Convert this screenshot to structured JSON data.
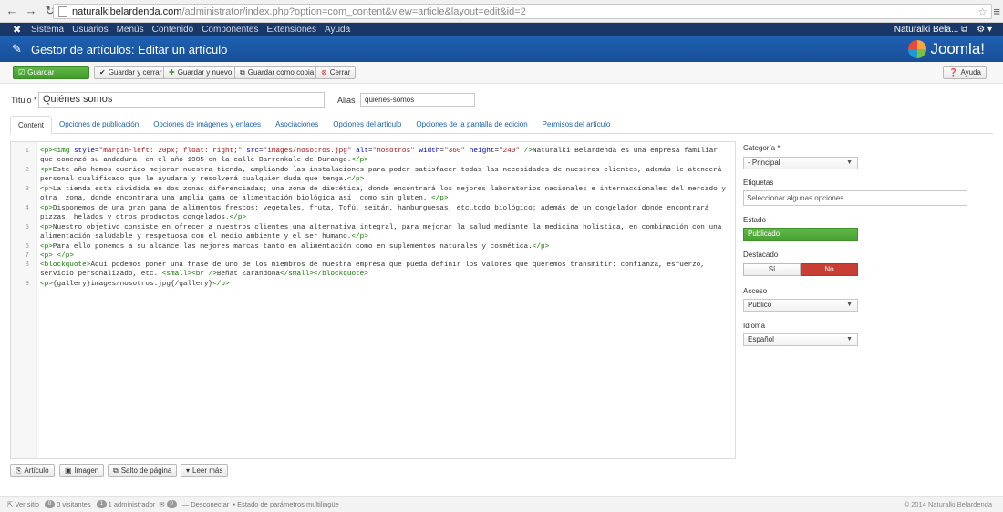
{
  "browser": {
    "url_host": "naturalkibelardenda.com",
    "url_path": "/administrator/index.php?option=com_content&view=article&layout=edit&id=2"
  },
  "topnav": {
    "items": [
      "Sistema",
      "Usuarios",
      "Menús",
      "Contenido",
      "Componentes",
      "Extensiones",
      "Ayuda"
    ],
    "user": "Naturalki Bela...",
    "icons": [
      "joomla-icon",
      "external-link-icon",
      "gear-icon"
    ]
  },
  "header": {
    "title": "Gestor de artículos: Editar un artículo",
    "brand": "Joomla!"
  },
  "toolbar": {
    "save": "Guardar",
    "save_close": "Guardar y cerrar",
    "save_new": "Guardar y nuevo",
    "save_copy": "Guardar como copia",
    "close": "Cerrar",
    "help": "Ayuda"
  },
  "form": {
    "title_label": "Título *",
    "title_value": "Quiénes somos",
    "alias_label": "Alias",
    "alias_value": "quienes-somos"
  },
  "tabs": [
    "Content",
    "Opciones de publicación",
    "Opciones de imágenes y enlaces",
    "Asociaciones",
    "Opciones del artículo",
    "Opciones de la pantalla de edición",
    "Permisos del artículo"
  ],
  "editor": {
    "line_numbers": [
      "1",
      "2",
      "3",
      "4",
      "5",
      "6",
      "7",
      "8",
      "9"
    ],
    "lines": [
      "<p><img style=\"margin-left: 20px; float: right;\" src=\"images/nosotros.jpg\" alt=\"nosotros\" width=\"360\" height=\"240\" />Naturalki Belardenda es una empresa familiar que comenzó su andadura  en el año 1985 en la calle Barrenkale de Durango.</p>",
      "<p>Este año hemos querido mejorar nuestra tienda, ampliando las instalaciones para poder satisfacer todas las necesidades de nuestros clientes, además le atenderá personal cualificado que le ayudara y resolverá cualquier duda que tenga.</p>",
      "<p>La tienda esta dividida en dos zonas diferenciadas; una zona de dietética, donde encontrará los mejores laboratorios nacionales e internaccíonales del mercado y otra  zona, donde encontrara una amplia gama de alimentación biológica así  como sin gluten. </p>",
      "<p>Disponemos de una gran gama de alimentos frescos; vegetales, fruta, Tofú, seitán, hamburguesas, etc…todo biológico; además de un congelador donde encontrará pizzas, helados y otros productos congelados.</p>",
      "<p>Nuestro objetivo consiste en ofrecer a nuestros clientes una alternativa integral, para mejorar la salud mediante la medicina holística, en combinación con una alimentación saludable y respetuosa con el medio ambiente y el ser humano.</p>",
      "<p>Para ello ponemos a su alcance las mejores marcas tanto en alimentación como en suplementos naturales y cosmética.</p>",
      "<p> </p>",
      "<blockquote>Aquí podemos poner una frase de uno de los miembros de nuestra empresa que pueda definir los valores que queremos transmitir: confianza, esfuerzo, servicio personalizado, etc. <small><br />Beñat Zarandona</small></blockquote>",
      "<p>{gallery}images/nosotros.jpg{/gallery}</p>"
    ]
  },
  "sidebar": {
    "category_label": "Categoría *",
    "category_value": "- Principal",
    "tags_label": "Etiquetas",
    "tags_placeholder": "Seleccionar algunas opciones",
    "state_label": "Estado",
    "state_value": "Publicado",
    "featured_label": "Destacado",
    "featured_yes": "Sí",
    "featured_no": "No",
    "access_label": "Acceso",
    "access_value": "Publico",
    "language_label": "Idioma",
    "language_value": "Español"
  },
  "editor_buttons": {
    "article": "Artículo",
    "image": "Imagen",
    "pagebreak": "Salto de página",
    "readmore": "Leer más"
  },
  "status": {
    "view_site": "Ver sitio",
    "visitors_count": "0",
    "visitors_label": "0 visitantes",
    "admins_count": "1",
    "admins_label": "1 administrador",
    "messages_count": "0",
    "logout": "Desconectar",
    "multilang": "Estado de parámetros multilingüe",
    "copyright": "© 2014 Naturalki Belardenda"
  },
  "colors": {
    "nav_bg": "#1a3867",
    "header_bg": "#1b57a7",
    "save_green": "#4aa336",
    "no_red": "#c93e33",
    "link_blue": "#1b62ad"
  }
}
